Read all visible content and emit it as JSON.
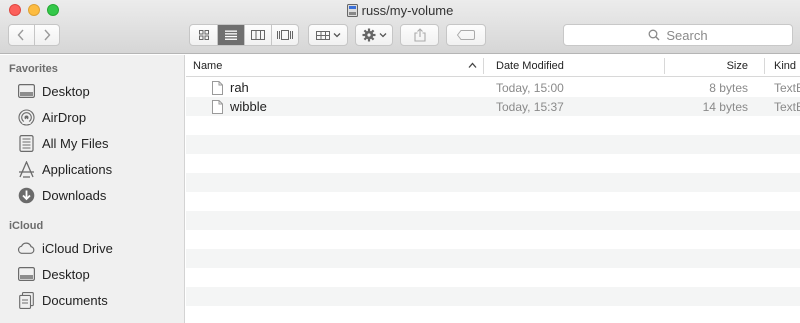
{
  "window": {
    "title": "russ/my-volume",
    "title_icon": "external-disk-icon"
  },
  "toolbar": {
    "back_icon": "chevron-left-icon",
    "forward_icon": "chevron-right-icon",
    "view_modes": [
      "icon-view-icon",
      "list-view-icon",
      "column-view-icon",
      "cover-flow-icon"
    ],
    "active_view": "list-view-icon",
    "arrange_icon": "arrange-grid-icon",
    "action_icon": "gear-icon",
    "share_icon": "share-icon",
    "tag_icon": "tag-icon",
    "search_placeholder": "Search"
  },
  "sidebar": {
    "favorites_label": "Favorites",
    "favorites": [
      {
        "label": "Desktop",
        "icon": "desktop-icon"
      },
      {
        "label": "AirDrop",
        "icon": "airdrop-icon"
      },
      {
        "label": "All My Files",
        "icon": "all-files-icon"
      },
      {
        "label": "Applications",
        "icon": "applications-icon"
      },
      {
        "label": "Downloads",
        "icon": "downloads-icon"
      }
    ],
    "icloud_label": "iCloud",
    "icloud": [
      {
        "label": "iCloud Drive",
        "icon": "cloud-icon"
      },
      {
        "label": "Desktop",
        "icon": "desktop-icon"
      },
      {
        "label": "Documents",
        "icon": "documents-icon"
      }
    ]
  },
  "columns": {
    "name": "Name",
    "date": "Date Modified",
    "size": "Size",
    "kind": "Kind"
  },
  "files": [
    {
      "name": "rah",
      "date": "Today, 15:00",
      "size": "8 bytes",
      "kind": "TextE"
    },
    {
      "name": "wibble",
      "date": "Today, 15:37",
      "size": "14 bytes",
      "kind": "TextE"
    }
  ]
}
